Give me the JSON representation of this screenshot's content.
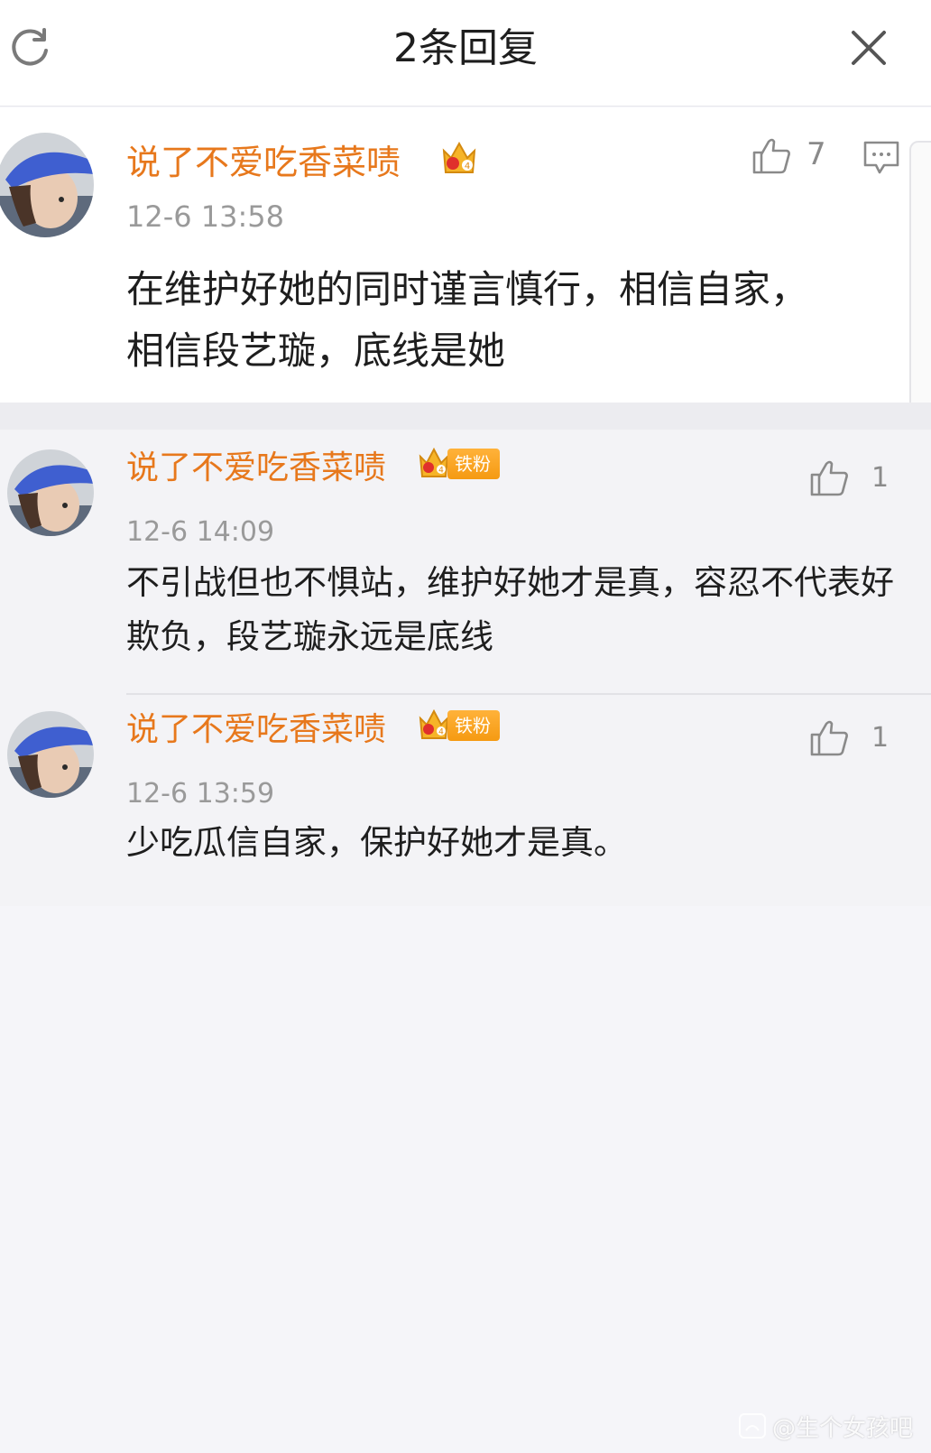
{
  "header": {
    "title": "2条回复",
    "refresh_icon": "refresh-icon",
    "close_icon": "close-icon"
  },
  "main_comment": {
    "username": "说了不爱吃香菜啧",
    "time": "12-6 13:58",
    "text": "在维护好她的同时谨言慎行，相信自家，相信段艺璇，底线是她",
    "likes": "7",
    "crown_level": "4"
  },
  "replies": [
    {
      "username": "说了不爱吃香菜啧",
      "badge_label": "铁粉",
      "crown_level": "4",
      "time": "12-6 14:09",
      "text": "不引战但也不惧站，维护好她才是真，容忍不代表好欺负，段艺璇永远是底线",
      "likes": "1"
    },
    {
      "username": "说了不爱吃香菜啧",
      "badge_label": "铁粉",
      "crown_level": "4",
      "time": "12-6 13:59",
      "text": "少吃瓜信自家，保护好她才是真。",
      "likes": "1"
    }
  ],
  "watermark": {
    "text": "@生个女孩吧"
  },
  "colors": {
    "username": "#e7781c",
    "badge": "#f59a12",
    "time": "#9a9a9a",
    "background": "#f5f5f9"
  }
}
